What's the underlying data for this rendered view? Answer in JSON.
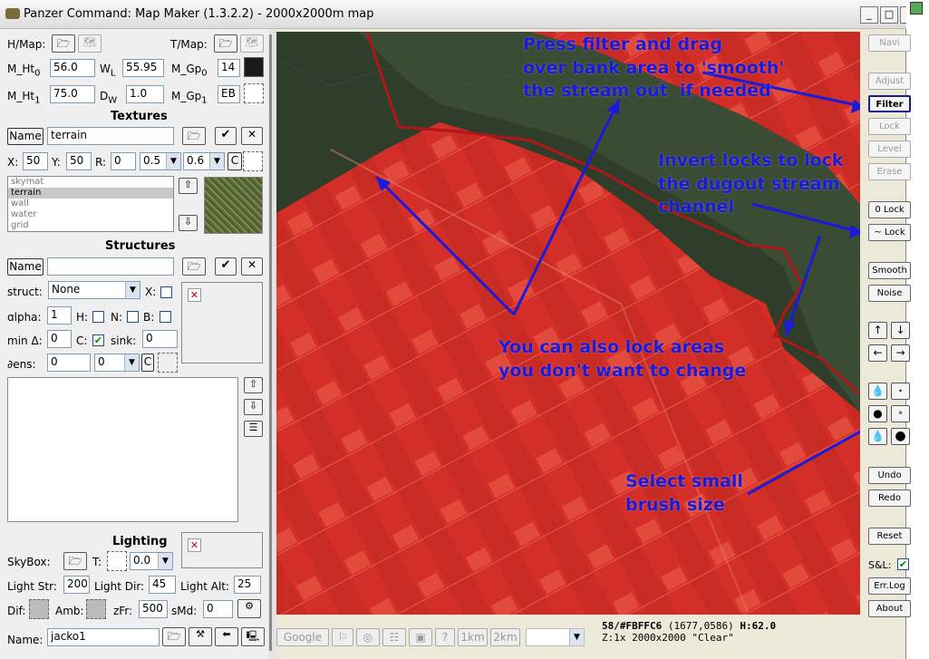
{
  "window": {
    "title": "Panzer Command: Map Maker (1.3.2.2) - 2000x2000m map",
    "minimize": "_",
    "maximize": "□",
    "close": "✕"
  },
  "header": {
    "hmap_label": "H/Map:",
    "tmap_label": "T/Map:",
    "m_ht0_label": "M_Ht",
    "m_ht0_sub": "0",
    "m_ht0_value": "56.0",
    "wl_label": "W",
    "wl_sub": "L",
    "wl_value": "55.95",
    "m_gp0_label": "M_Gp",
    "m_gp0_sub": "0",
    "m_gp0_value": "14",
    "m_ht1_label": "M_Ht",
    "m_ht1_sub": "1",
    "m_ht1_value": "75.0",
    "dw_label": "D",
    "dw_sub": "W",
    "dw_value": "1.0",
    "m_gp1_label": "M_Gp",
    "m_gp1_sub": "1",
    "m_gp1_value": "EB"
  },
  "textures": {
    "heading": "Textures",
    "name_button": "Name",
    "name_value": "terrain",
    "x_label": "X:",
    "x_value": "50",
    "y_label": "Y:",
    "y_value": "50",
    "r_label": "R:",
    "r_value": "0",
    "dd1_value": "0.5",
    "dd2_value": "0.6",
    "c_button": "C",
    "list": [
      {
        "label": "skymat",
        "selected": false
      },
      {
        "label": "terrain",
        "selected": true
      },
      {
        "label": "wall",
        "selected": false
      },
      {
        "label": "water",
        "selected": false
      },
      {
        "label": "grid",
        "selected": false
      }
    ]
  },
  "structures": {
    "heading": "Structures",
    "name_button": "Name",
    "name_value": "",
    "struct_label": "struct:",
    "struct_value": "None",
    "x_label": "X:",
    "alpha_label": "ɑlpha:",
    "alpha_value": "1",
    "h_label": "H:",
    "n_label": "N:",
    "b_label": "B:",
    "min_label": "min Δ:",
    "min_value": "0",
    "c_label": "C:",
    "sink_label": "sink:",
    "sink_value": "0",
    "dens_label": "∂ens:",
    "dens_value": "0",
    "dens_dd_value": "0",
    "c_button": "C"
  },
  "lighting": {
    "heading": "Lighting",
    "skybox_label": "SkyBox:",
    "t_label": "T:",
    "t_value": "0.0",
    "light_str_label": "Light Str:",
    "light_str_value": "200",
    "light_dir_label": "Light Dir:",
    "light_dir_value": "45",
    "light_alt_label": "Light Alt:",
    "light_alt_value": "25",
    "dif_label": "Dif:",
    "amb_label": "Amb:",
    "zfr_label": "zFr:",
    "zfr_value": "500",
    "smd_label": "sMd:",
    "smd_value": "0"
  },
  "footer": {
    "name_label": "Name:",
    "name_value": "jacko1"
  },
  "annotations": {
    "filter_text": "Press filter and drag\nover bank area to 'smooth'\nthe stream out  if needed",
    "invert_text": "Invert locks to lock\nthe dugout stream\nchannel",
    "lock_text": "You can also lock areas\nyou don't want to change",
    "brush_text": "Select small\nbrush size"
  },
  "right_toolbar": {
    "navi": "Navi",
    "adjust": "Adjust",
    "filter": "Filter",
    "lock": "Lock",
    "level": "Level",
    "erase": "Erase",
    "zero_lock": "0 Lock",
    "inv_lock": "~ Lock",
    "smooth": "Smooth",
    "noise": "Noise",
    "undo": "Undo",
    "redo": "Redo",
    "reset": "Reset",
    "sl_label": "S&L:",
    "errlog": "Err.Log",
    "about": "About"
  },
  "bottom_bar": {
    "google": "Google",
    "one_km": "1km",
    "two_km": "2km",
    "help": "?"
  },
  "status": {
    "line1_a": "58/#FBFFC6",
    "line1_b": "(1677,0586)",
    "line1_c": "H:62.0",
    "line2": "Z:1x 2000x2000 \"Clear\""
  },
  "colors": {
    "overlay_red": "#d8322a",
    "annotation_blue": "#1a1adb",
    "forest_dark": "#2a3a26"
  }
}
